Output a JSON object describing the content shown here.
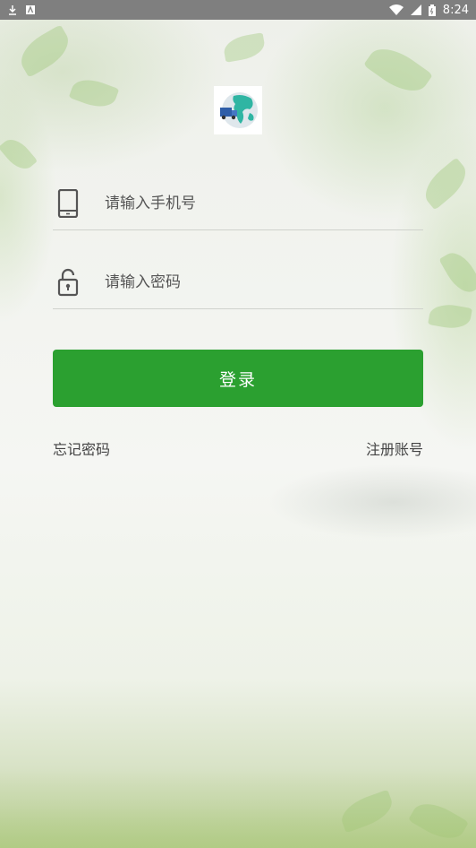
{
  "status_bar": {
    "time": "8:24",
    "left_icons": [
      "download-icon",
      "notification-icon"
    ],
    "right_icons": [
      "wifi-icon",
      "signal-icon",
      "battery-icon"
    ]
  },
  "logo": {
    "icon": "globe-truck-logo-icon"
  },
  "phone_field": {
    "placeholder": "请输入手机号",
    "value": "",
    "icon": "phone-icon"
  },
  "password_field": {
    "placeholder": "请输入密码",
    "value": "",
    "icon": "lock-icon"
  },
  "login_button": {
    "label": "登录",
    "color": "#2ba030"
  },
  "links": {
    "forgot_password": "忘记密码",
    "register": "注册账号"
  }
}
